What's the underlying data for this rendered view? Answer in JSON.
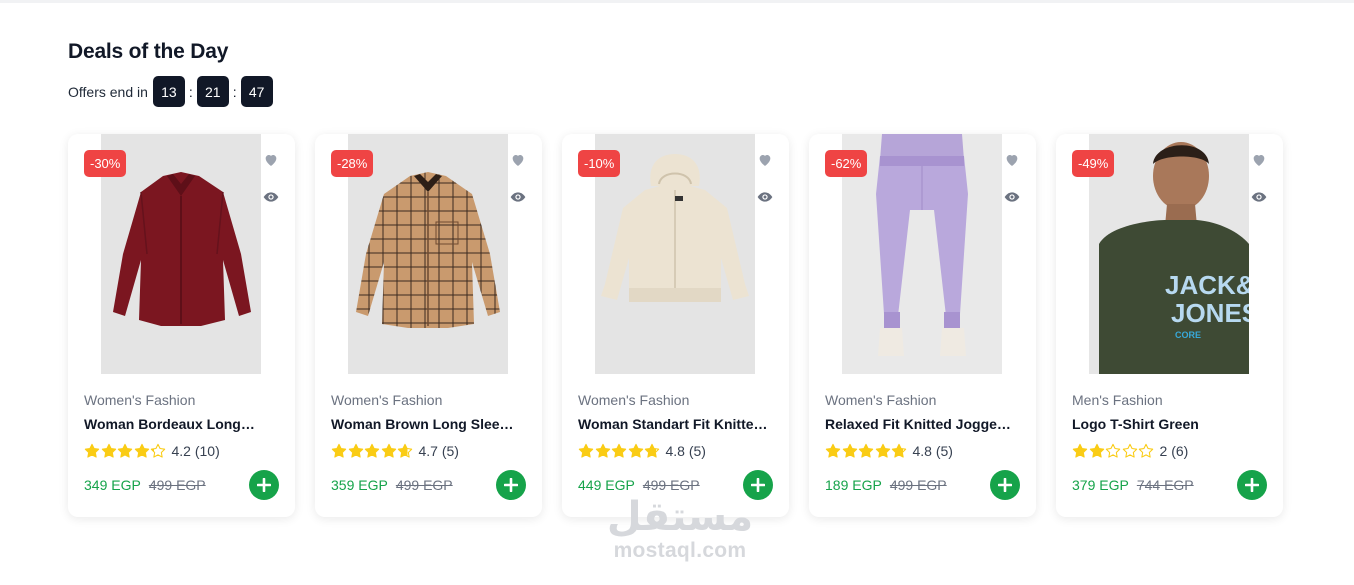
{
  "section": {
    "title": "Deals of the Day",
    "timer_label": "Offers end in",
    "timer": {
      "hours": "13",
      "minutes": "21",
      "seconds": "47"
    }
  },
  "products": [
    {
      "discount": "-30%",
      "category": "Women's Fashion",
      "name": "Woman Bordeaux Long…",
      "rating": "4.2",
      "reviews": "(10)",
      "stars": 4.2,
      "price": "349 EGP",
      "old_price": "499 EGP",
      "image_icon": "burgundy-shirt-image"
    },
    {
      "discount": "-28%",
      "category": "Women's Fashion",
      "name": "Woman Brown Long Sleev…",
      "rating": "4.7",
      "reviews": "(5)",
      "stars": 4.7,
      "price": "359 EGP",
      "old_price": "499 EGP",
      "image_icon": "plaid-shirt-image"
    },
    {
      "discount": "-10%",
      "category": "Women's Fashion",
      "name": "Woman Standart Fit Knitte…",
      "rating": "4.8",
      "reviews": "(5)",
      "stars": 4.8,
      "price": "449 EGP",
      "old_price": "499 EGP",
      "image_icon": "beige-hoodie-image"
    },
    {
      "discount": "-62%",
      "category": "Women's Fashion",
      "name": "Relaxed Fit Knitted Jogger…",
      "rating": "4.8",
      "reviews": "(5)",
      "stars": 4.8,
      "price": "189 EGP",
      "old_price": "499 EGP",
      "image_icon": "lilac-joggers-image"
    },
    {
      "discount": "-49%",
      "category": "Men's Fashion",
      "name": "Logo T-Shirt Green",
      "rating": "2",
      "reviews": "(6)",
      "stars": 2,
      "price": "379 EGP",
      "old_price": "744 EGP",
      "image_icon": "green-tshirt-image",
      "print_text": [
        "JACK&",
        "JONES",
        "CORE"
      ]
    }
  ],
  "colors": {
    "accent_green": "#16a34a",
    "badge_red": "#ef4444",
    "timer_bg": "#111827",
    "star": "#facc15"
  },
  "watermark": {
    "arabic": "مستقل",
    "latin": "mostaql.com"
  }
}
